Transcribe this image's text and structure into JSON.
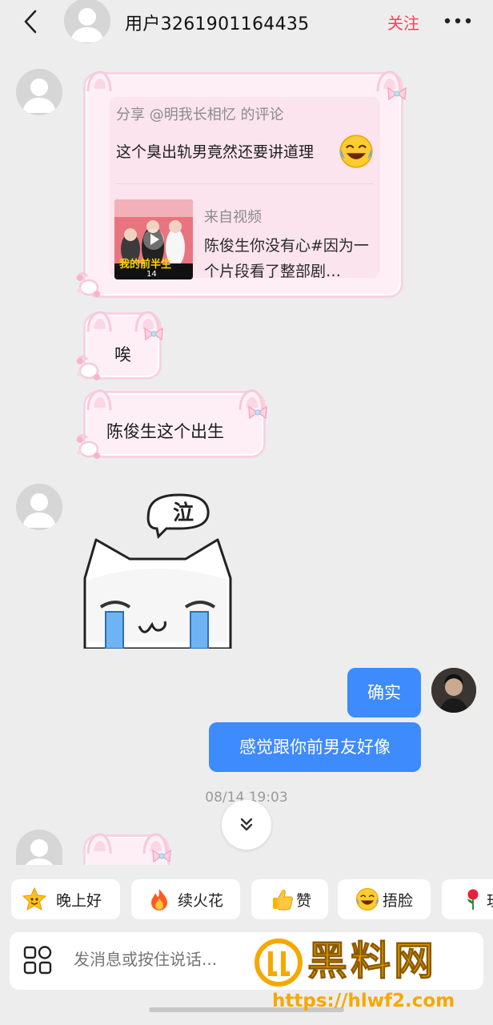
{
  "header": {
    "title": "用户3261901164435",
    "follow_label": "关注",
    "icons": [
      "back-icon",
      "avatar",
      "more-icon"
    ]
  },
  "share_card": {
    "from_label": "分享 @明我长相忆 的评论",
    "comment_text": "这个臭出轨男竟然还要讲道理",
    "comment_emoji": "laugh-cry-emoji",
    "thumbnail_texts": [
      "我的前半生",
      "14"
    ],
    "video_source": "来自视频",
    "video_title": "陈俊生你没有心#因为一个片段看了整部剧…"
  },
  "messages": {
    "incoming_1": "唉",
    "incoming_2": "陈俊生这个出生",
    "sticker_bubble_text": "泣",
    "outgoing_1": "确实",
    "outgoing_2": "感觉跟你前男友好像"
  },
  "timestamp": "08/14 19:03",
  "quick_replies": [
    {
      "emoji": "star-face-emoji",
      "label": "晚上好"
    },
    {
      "emoji": "fire-emoji",
      "label": "续火花"
    },
    {
      "emoji": "thumbs-up-emoji",
      "label": "赞"
    },
    {
      "emoji": "laugh-cry-emoji",
      "label": "捂脸"
    },
    {
      "emoji": "rose-emoji",
      "label": "玫"
    }
  ],
  "input": {
    "placeholder": "发消息或按住说话..."
  },
  "watermark": {
    "text": "黑料网",
    "url": "https://hlwf2.com"
  },
  "colors": {
    "background": "#ededed",
    "accent_follow": "#ff3b5c",
    "outgoing_bubble": "#3d8bfd",
    "pink_bubble": "#fdeff5",
    "watermark": "#f5a800"
  }
}
